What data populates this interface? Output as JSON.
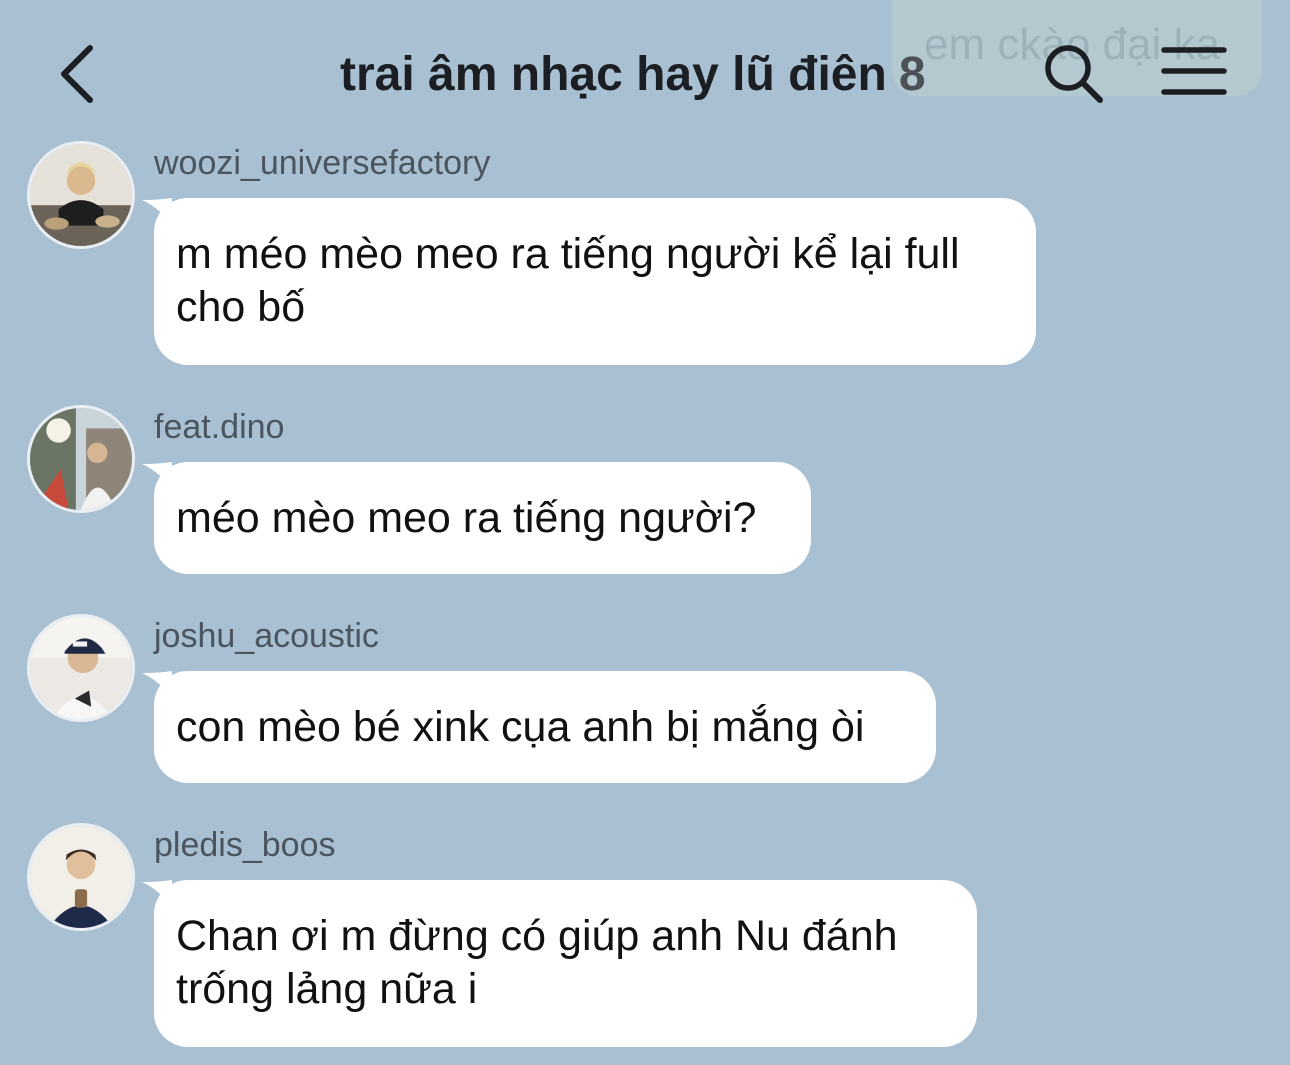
{
  "header": {
    "title": "trai âm nhạc hay lũ điên",
    "member_count": "8",
    "ghost_text": "em ckào đại ka",
    "icons": {
      "back": "chevron-left-icon",
      "search": "search-icon",
      "menu": "hamburger-menu-icon"
    }
  },
  "messages": [
    {
      "username": "woozi_universefactory",
      "text": "m méo mèo meo ra tiếng người kể lại full cho bố"
    },
    {
      "username": "feat.dino",
      "text": "méo mèo meo ra tiếng người?"
    },
    {
      "username": "joshu_acoustic",
      "text": "con mèo bé xink cụa anh bị mắng òi"
    },
    {
      "username": "pledis_boos",
      "text": "Chan ơi m đừng có giúp anh Nu đánh trống lảng nữa i"
    }
  ],
  "colors": {
    "background": "#a9c0d2",
    "bubble": "#ffffff",
    "text": "#111111",
    "username": "#4a5560"
  }
}
